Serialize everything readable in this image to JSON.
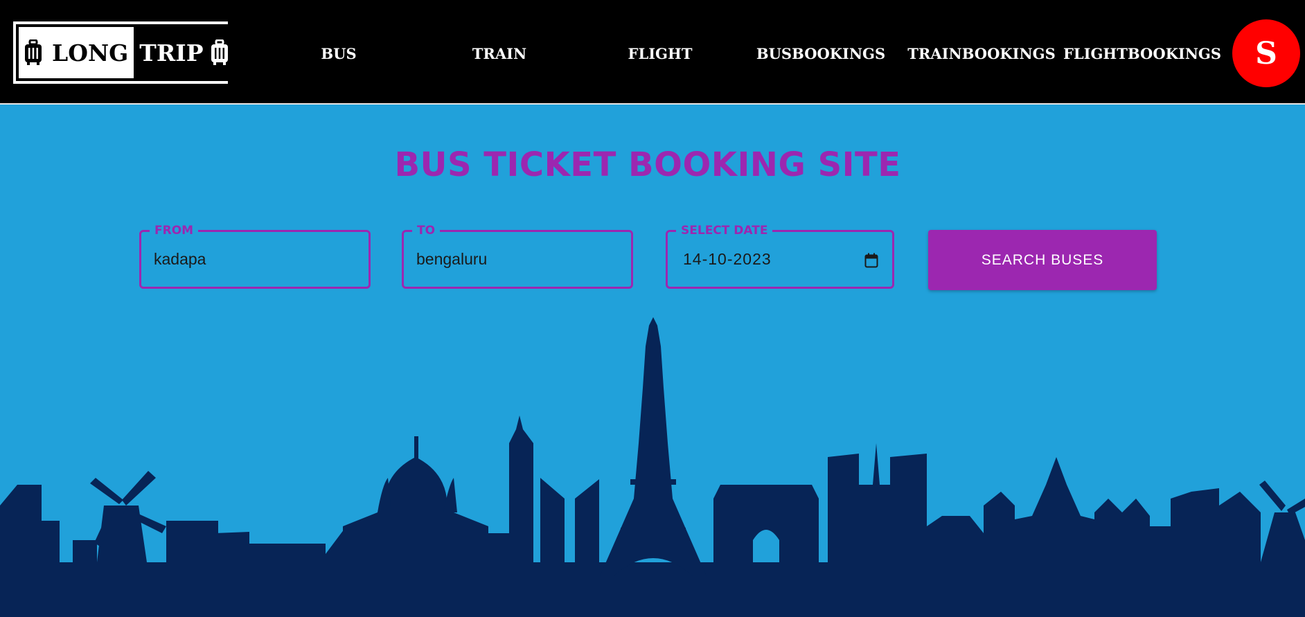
{
  "header": {
    "logo": {
      "left_text": "LONG",
      "right_text": "TRIP",
      "icon": "luggage-icon"
    },
    "nav": [
      {
        "label": "BUS"
      },
      {
        "label": "TRAIN"
      },
      {
        "label": "FLIGHT"
      },
      {
        "label": "BUSBOOKINGS"
      },
      {
        "label": "TRAINBOOKINGS"
      },
      {
        "label": "FLIGHTBOOKINGS"
      }
    ],
    "avatar": {
      "initial": "S",
      "color": "#ff0000"
    }
  },
  "main": {
    "title": "BUS TICKET BOOKING SITE",
    "from": {
      "label": "FROM",
      "value": "kadapa"
    },
    "to": {
      "label": "TO",
      "value": "bengaluru"
    },
    "date": {
      "label": "SELECT DATE",
      "value": "14-10-2023",
      "icon": "calendar-icon"
    },
    "search_label": "SEARCH BUSES"
  },
  "colors": {
    "background": "#21a1da",
    "header": "#000000",
    "accent": "#9c27b0",
    "skyline": "#072456"
  }
}
